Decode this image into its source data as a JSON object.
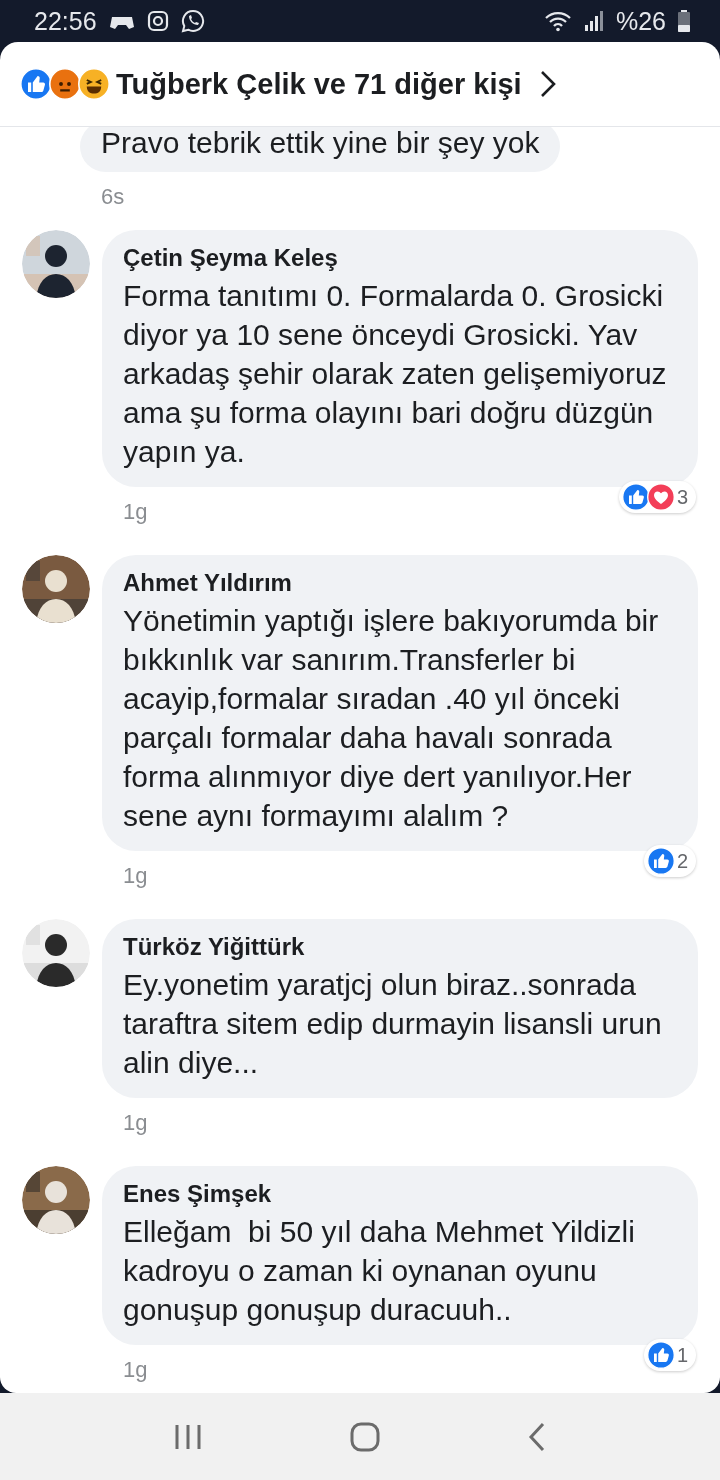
{
  "status_bar": {
    "time": "22:56",
    "battery": "%26"
  },
  "header": {
    "title": "Tuğberk Çelik ve 71 diğer kişi",
    "reactions": [
      {
        "kind": "like"
      },
      {
        "kind": "angry"
      },
      {
        "kind": "haha"
      }
    ]
  },
  "comments": [
    {
      "kind": "partial",
      "text": "Pravo tebrik ettik yine bir şey yok",
      "time": "6s"
    },
    {
      "kind": "full",
      "name": "Çetin Şeyma Keleş",
      "text": "Forma tanıtımı 0. Formalarda 0. Grosicki diyor ya 10 sene önceydi Grosicki. Yav arkadaş şehir olarak zaten gelişemiyoruz ama şu forma olayını bari doğru düzgün yapın ya.",
      "time": "1g",
      "reactions": {
        "kinds": [
          {
            "kind": "like"
          },
          {
            "kind": "love"
          }
        ],
        "count": "3"
      }
    },
    {
      "kind": "full",
      "name": "Ahmet Yıldırım",
      "text": "Yönetimin yaptığı işlere bakıyorumda bir bıkkınlık var sanırım.Transferler bi acayip,formalar sıradan .40 yıl önceki parçalı formalar daha havalı sonrada forma alınmıyor diye dert yanılıyor.Her sene aynı formayımı alalım ?",
      "time": "1g",
      "reactions": {
        "kinds": [
          {
            "kind": "like"
          }
        ],
        "count": "2"
      }
    },
    {
      "kind": "full",
      "name": "Türköz Yiğittürk",
      "text": "Ey.yonetim yaratjcj olun biraz..sonrada taraftra sitem edip durmayin lisansli urun alin diye...",
      "time": "1g"
    },
    {
      "kind": "full",
      "name": "Enes Şimşek",
      "text": "Elleğam  bi 50 yıl daha Mehmet Yildizli kadroyu o zaman ki oynanan oyunu gonuşup gonuşup duracuuh..",
      "time": "1g",
      "reactions": {
        "kinds": [
          {
            "kind": "like"
          }
        ],
        "count": "1"
      }
    }
  ]
}
